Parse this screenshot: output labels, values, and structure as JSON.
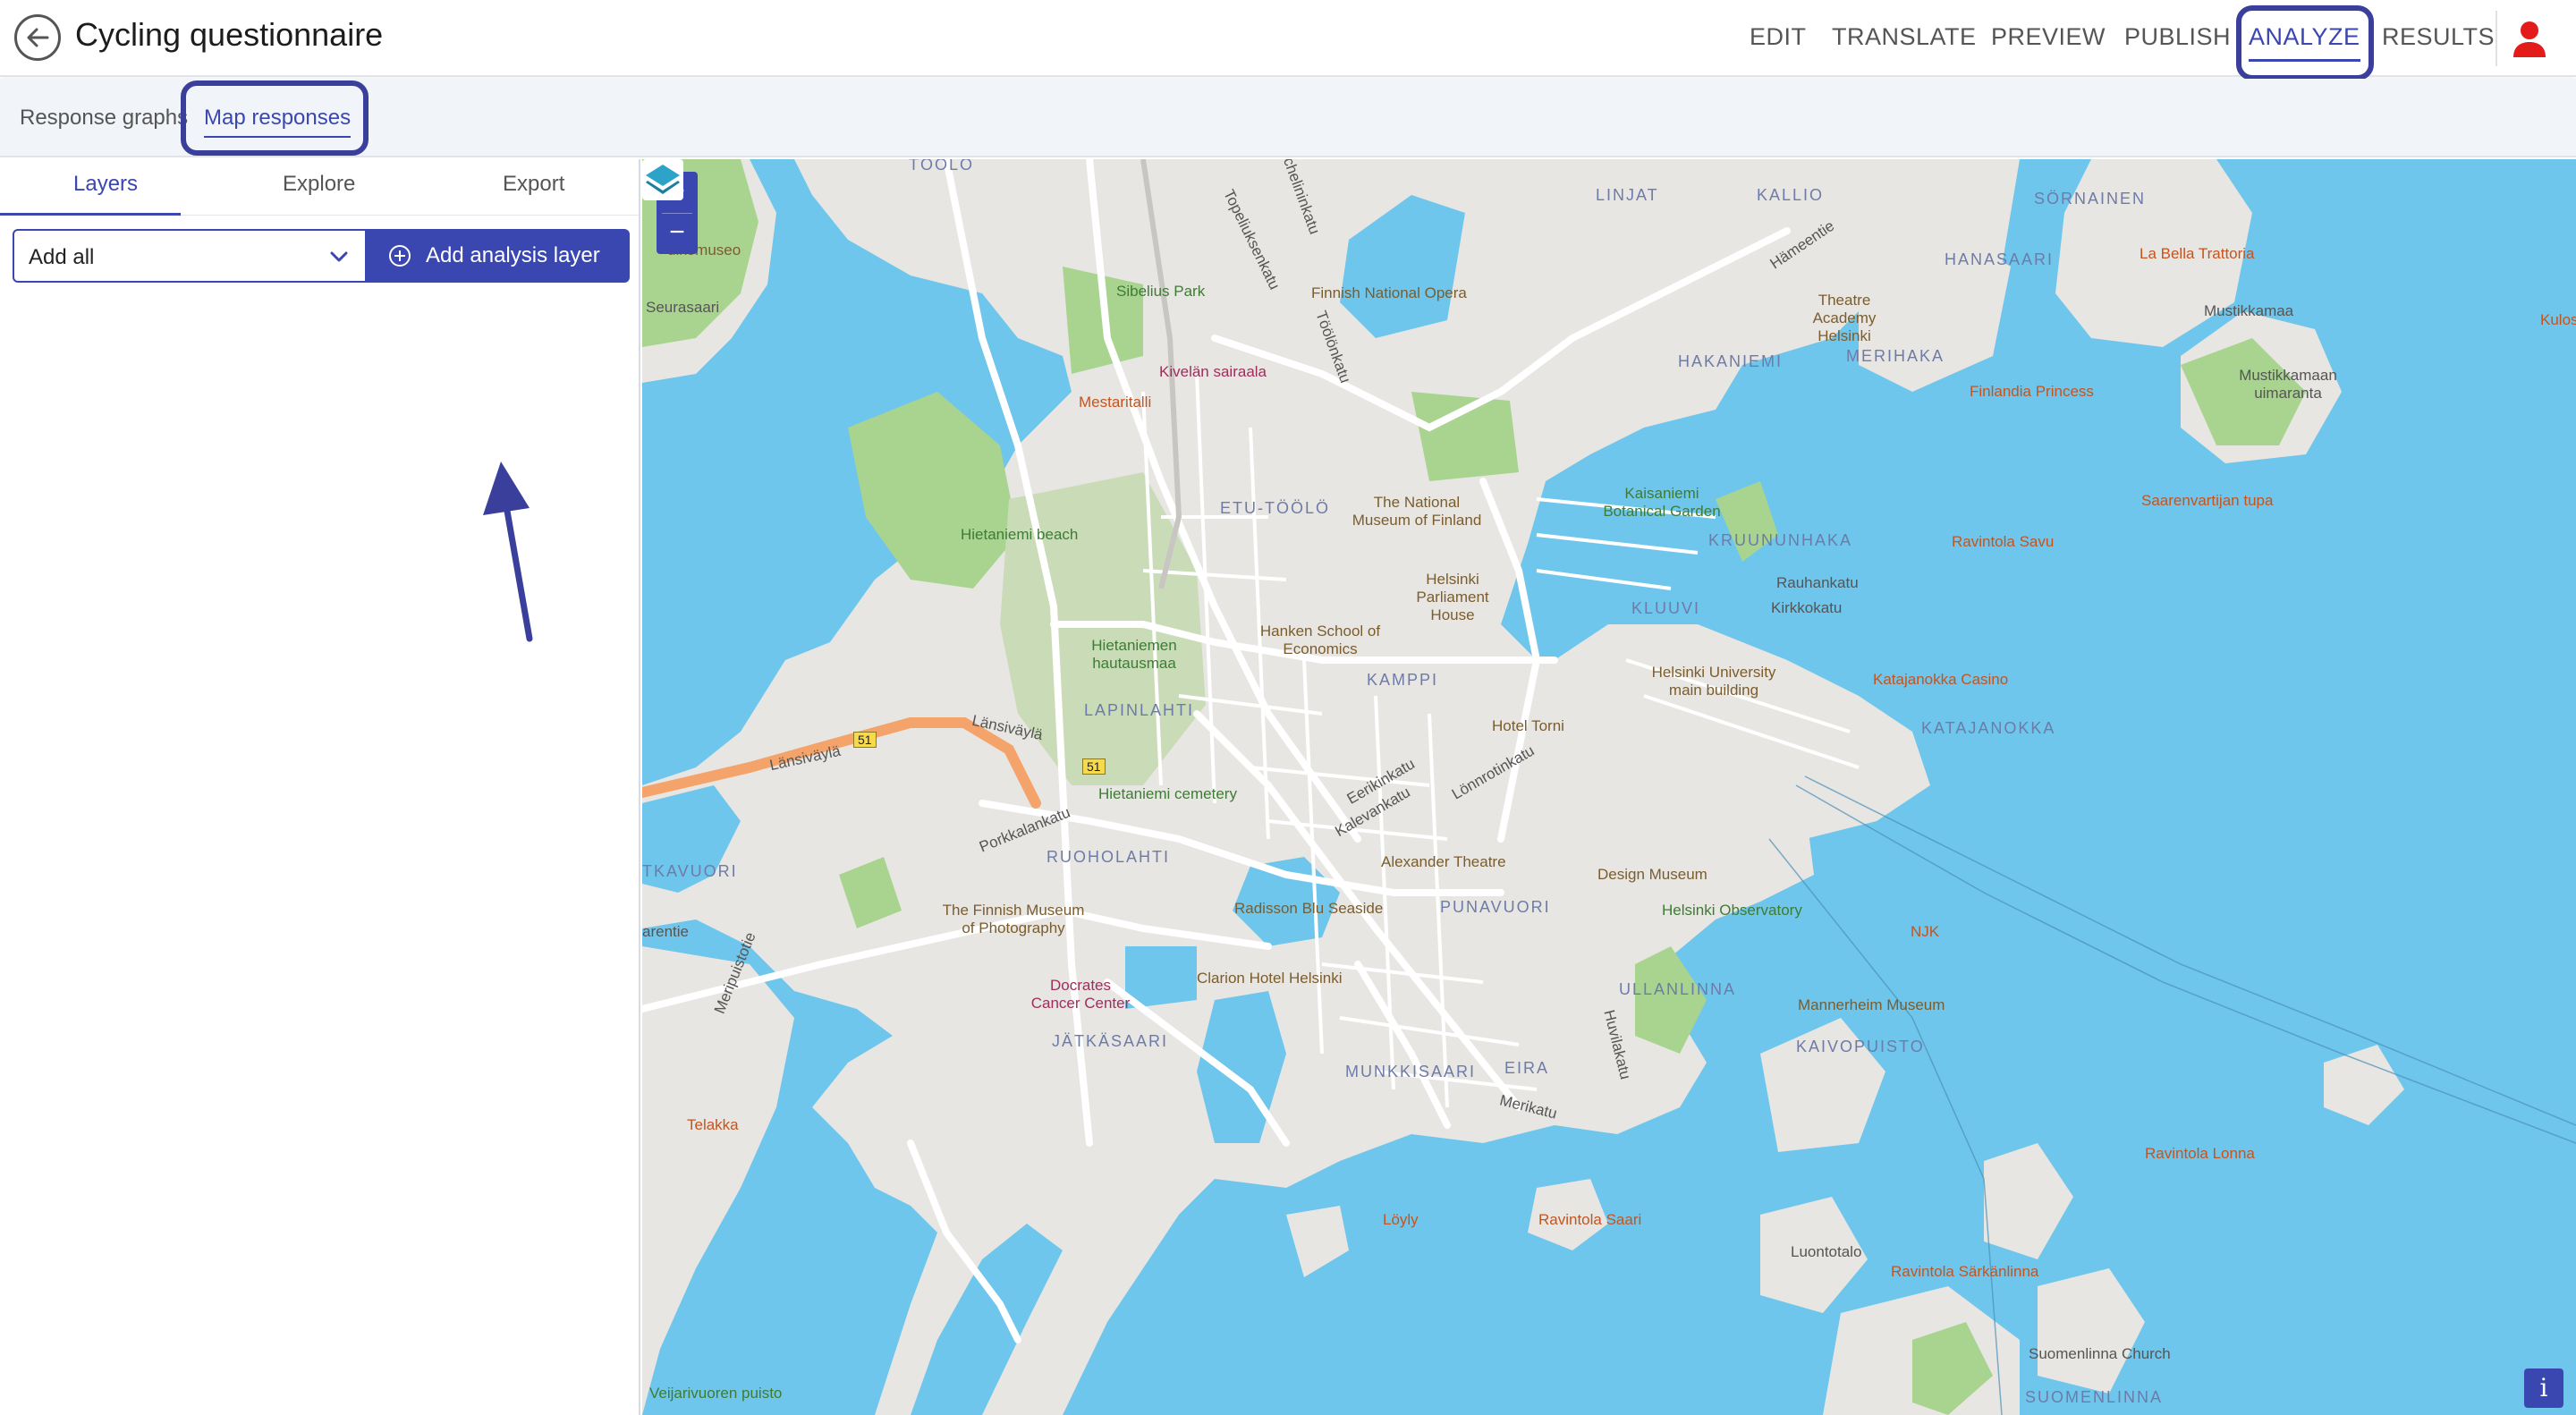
{
  "header": {
    "title": "Cycling questionnaire",
    "nav": [
      "EDIT",
      "TRANSLATE",
      "PREVIEW",
      "PUBLISH",
      "ANALYZE",
      "RESULTS"
    ],
    "active_nav": "ANALYZE"
  },
  "subtabs": {
    "items": [
      "Response graphs",
      "Map responses"
    ],
    "active": "Map responses"
  },
  "left_panel": {
    "tabs": [
      "Layers",
      "Explore",
      "Export"
    ],
    "active_tab": "Layers",
    "select_value": "Add all",
    "add_button_label": "Add analysis layer"
  },
  "map": {
    "zoom_in": "+",
    "zoom_out": "−",
    "info": "i",
    "districts": [
      "TÖÖLÖ",
      "LINJAT",
      "KALLIO",
      "SÖRNAINEN",
      "HANASAARI",
      "HAKANIEMI",
      "MERIHAKA",
      "ETU-TÖÖLÖ",
      "KRUUNUNHAKA",
      "KLUUVI",
      "KAMPPI",
      "LAPINLAHTI",
      "KATAJANOKKA",
      "RUOHOLAHTI",
      "PUNAVUORI",
      "ULLANLINNA",
      "KAIVOPUISTO",
      "JÄTKÄSAARI",
      "MUNKKISAARI",
      "EIRA",
      "SUOMENLINNA",
      "TKAVUORI"
    ],
    "places": {
      "sibelius_park": "Sibelius Park",
      "kivelan": "Kivelän sairaala",
      "national_opera": "Finnish National Opera",
      "theatre_academy": "Theatre Academy Helsinki",
      "la_bella": "La Bella Trattoria",
      "kulosaari": "Kulosa",
      "mustikkamaa": "Mustikkamaa",
      "mustikkamaan_uimaranta": "Mustikkamaan uimaranta",
      "finlandia_princess": "Finlandia Princess",
      "mestaritalli": "Mestaritalli",
      "seurasaari": "Seurasaari",
      "ulkomuseo": "ulkomuseo",
      "kaisaniemi": "Kaisaniemi Botanical Garden",
      "saarenvartijan": "Saarenvartijan tupa",
      "ravintola_savu": "Ravintola Savu",
      "national_museum": "The National Museum of Finland",
      "hietaniemi_beach": "Hietaniemi beach",
      "parliament": "Helsinki Parliament House",
      "rauhankatu": "Rauhankatu",
      "kirkkokatu": "Kirkkokatu",
      "hanken": "Hanken School of Economics",
      "hietaniemen_hautausmaa": "Hietaniemen hautausmaa",
      "university": "Helsinki University main building",
      "katajanokka_casino": "Katajanokka Casino",
      "hotel_torni": "Hotel Torni",
      "lansivayla1": "Länsiväylä",
      "lansivayla2": "Länsiväylä",
      "hietaniemi_cemetery": "Hietaniemi cemetery",
      "porkkalankatu": "Porkkalankatu",
      "eerikinkatu": "Eerikinkatu",
      "kalevankatu": "Kalevankatu",
      "lonnrotinkatu": "Lönnrotinkatu",
      "alexander": "Alexander Theatre",
      "design_museum": "Design Museum",
      "observatory": "Helsinki Observatory",
      "photography": "The Finnish Museum of Photography",
      "radisson": "Radisson Blu Seaside",
      "njk": "NJK",
      "docrates": "Docrates Cancer Center",
      "clarion": "Clarion Hotel Helsinki",
      "mannerheim": "Mannerheim Museum",
      "telakka": "Telakka",
      "meripuistotie": "Meripuistotie",
      "arentie": "arentie",
      "huvilakatu": "Huvilakatu",
      "merikatu": "Merikatu",
      "ravintola_lonna": "Ravintola Lonna",
      "luontotalo": "Luontotalo",
      "loyly": "Löyly",
      "ravintola_saari": "Ravintola Saari",
      "ravintola_sarkanlinna": "Ravintola Särkänlinna",
      "suomenlinna_church": "Suomenlinna Church",
      "veijarivuoren": "Veijarivuoren puisto",
      "mechelininkatu": "Topeliuksenkatu",
      "runeberginkatu": "Mechelininkatu",
      "toolonkatu": "Töölönkatu",
      "hameentie": "Hämeentie",
      "route_51": "51"
    }
  }
}
